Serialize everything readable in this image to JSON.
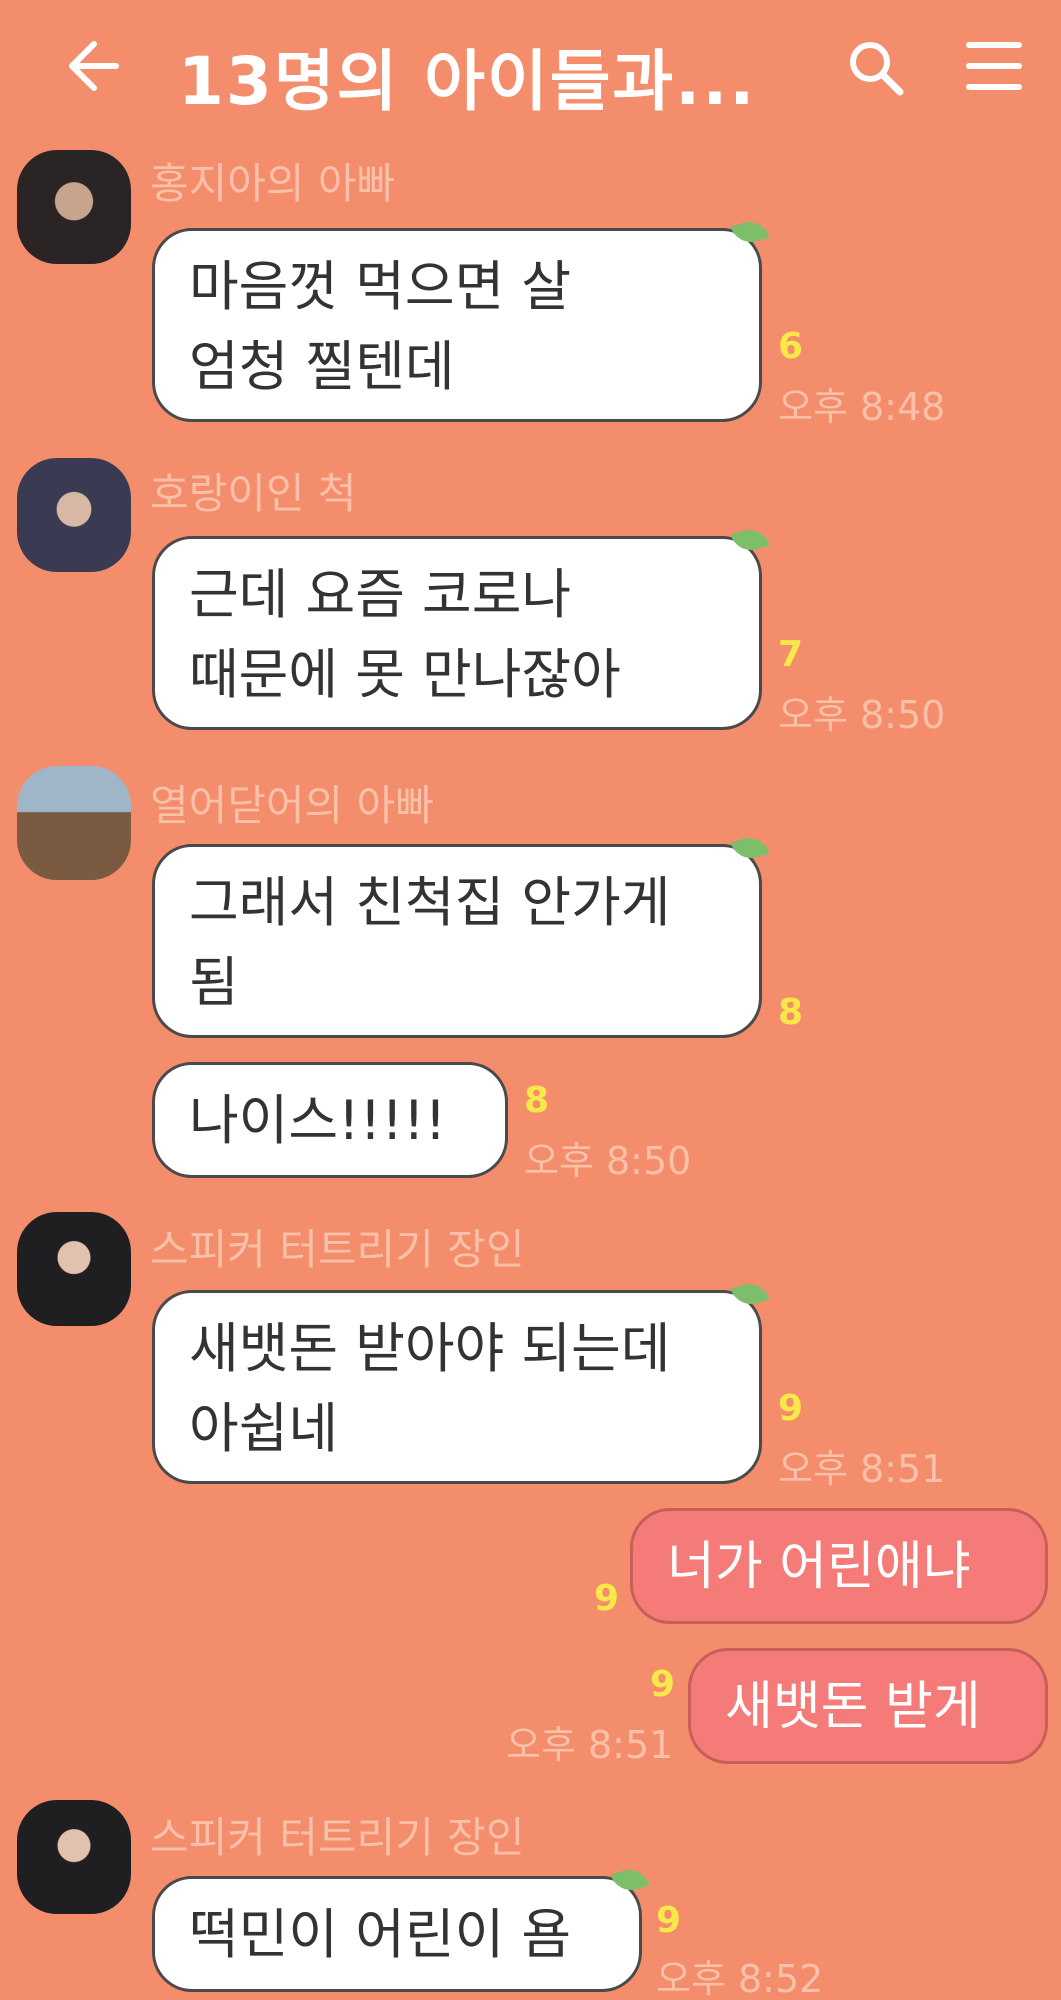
{
  "header": {
    "title": "13명의 아이들과...",
    "back_icon": "back-arrow-icon",
    "search_icon": "search-icon",
    "menu_icon": "hamburger-menu-icon",
    "text_color": "#FFFFFF"
  },
  "theme": {
    "background": "#F38D6B",
    "bubble_other": "#FFFFFF",
    "bubble_mine": "#F57B78",
    "unread_count_color": "#F9E84A",
    "sender_color": "#FBC0A9"
  },
  "messages": [
    {
      "sender": "홍지아의 아빠",
      "lines": [
        "마음껏 먹으면 살",
        "엄청 찔텐데"
      ],
      "unread": "6",
      "time": "오후 8:48"
    },
    {
      "sender": "호랑이인 척",
      "lines": [
        "근데 요즘 코로나",
        "때문에 못 만나잖아"
      ],
      "unread": "7",
      "time": "오후 8:50"
    },
    {
      "sender": "열어닫어의 아빠",
      "lines": [
        "그래서 친척집 안가게",
        "됨"
      ],
      "unread": "8",
      "time": ""
    },
    {
      "sender": "",
      "lines": [
        "나이스!!!!!"
      ],
      "unread": "8",
      "time": "오후 8:50"
    },
    {
      "sender": "스피커 터트리기 장인",
      "lines": [
        "새뱃돈 받아야 되는데",
        "아쉽네"
      ],
      "unread": "9",
      "time": "오후 8:51"
    },
    {
      "sender": "me",
      "lines": [
        "너가 어린애냐"
      ],
      "unread": "9",
      "time": ""
    },
    {
      "sender": "me",
      "lines": [
        "새뱃돈 받게"
      ],
      "unread": "9",
      "time": "오후 8:51"
    },
    {
      "sender": "스피커 터트리기 장인",
      "lines": [
        "떡민이 어린이 욤"
      ],
      "unread": "9",
      "time": "오후 8:52"
    }
  ]
}
